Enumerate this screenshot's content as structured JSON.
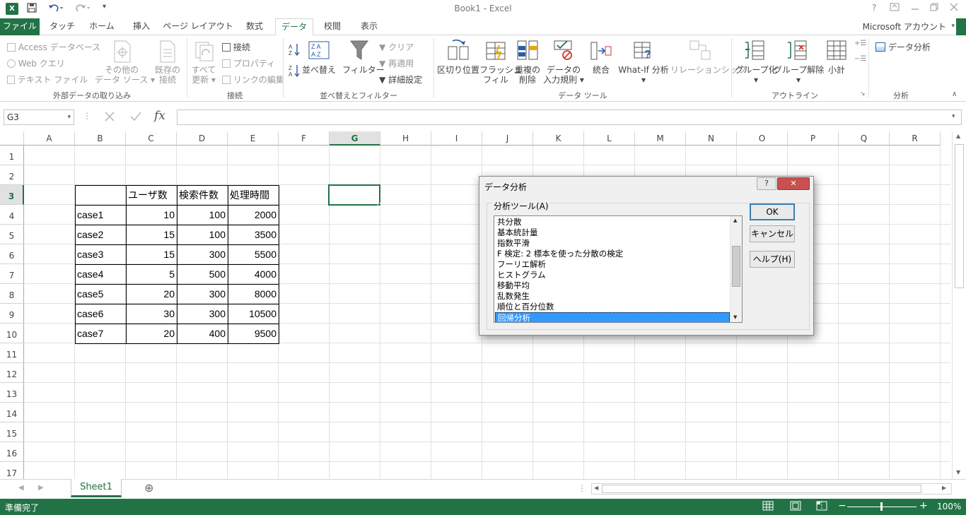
{
  "window": {
    "title": "Book1 - Excel",
    "app_icon": "X",
    "help": "?",
    "account": "Microsoft アカウント"
  },
  "tabs": [
    "ファイル",
    "タッチ",
    "ホーム",
    "挿入",
    "ページ レイアウト",
    "数式",
    "データ",
    "校閲",
    "表示"
  ],
  "ribbon": {
    "external": {
      "access": "Access データベース",
      "web": "Web クエリ",
      "text": "テキスト ファイル",
      "other_1": "その他の",
      "other_2": "データ ソース",
      "existing_1": "既存の",
      "existing_2": "接続",
      "label": "外部データの取り込み"
    },
    "connections": {
      "refresh_1": "すべて",
      "refresh_2": "更新",
      "connect": "接続",
      "props": "プロパティ",
      "edit_links": "リンクの編集",
      "label": "接続"
    },
    "sort": {
      "az": "A↓Z",
      "za": "Z↓A",
      "sort": "並べ替え",
      "filter": "フィルター",
      "clear": "クリア",
      "reapply": "再適用",
      "advanced": "詳細設定",
      "label": "並べ替えとフィルター"
    },
    "tools": {
      "split": "区切り位置",
      "flash_1": "フラッシュ",
      "flash_2": "フィル",
      "dup_1": "重複の",
      "dup_2": "削除",
      "valid_1": "データの",
      "valid_2": "入力規則",
      "consolidate": "統合",
      "whatif": "What-If 分析",
      "relation": "リレーションシップ",
      "label": "データ ツール"
    },
    "outline": {
      "group": "グループ化",
      "ungroup": "グループ解除",
      "subtotal": "小計",
      "label": "アウトライン"
    },
    "analysis": {
      "data_analysis": "データ分析",
      "label": "分析"
    }
  },
  "formula_bar": {
    "name_box": "G3",
    "formula": ""
  },
  "grid": {
    "columns": [
      "A",
      "B",
      "C",
      "D",
      "E",
      "F",
      "G",
      "H",
      "I",
      "J",
      "K",
      "L",
      "M",
      "N",
      "O",
      "P",
      "Q",
      "R"
    ],
    "rows": [
      "1",
      "2",
      "3",
      "4",
      "5",
      "6",
      "7",
      "8",
      "9",
      "10",
      "11",
      "12",
      "13",
      "14",
      "15",
      "16",
      "17"
    ],
    "selected_col": "G",
    "selected_row": "3"
  },
  "table": {
    "headers": [
      "",
      "ユーザ数",
      "検索件数",
      "処理時間"
    ],
    "rows": [
      [
        "case1",
        "10",
        "100",
        "2000"
      ],
      [
        "case2",
        "15",
        "100",
        "3500"
      ],
      [
        "case3",
        "15",
        "300",
        "5500"
      ],
      [
        "case4",
        "5",
        "500",
        "4000"
      ],
      [
        "case5",
        "20",
        "300",
        "8000"
      ],
      [
        "case6",
        "30",
        "300",
        "10500"
      ],
      [
        "case7",
        "20",
        "400",
        "9500"
      ]
    ]
  },
  "sheets": {
    "active": "Sheet1",
    "add": "⊕"
  },
  "status": {
    "ready": "準備完了",
    "zoom": "100%"
  },
  "dialog": {
    "title": "データ分析",
    "help": "?",
    "close": "✕",
    "tools_label": "分析ツール(A)",
    "items": [
      "共分散",
      "基本統計量",
      "指数平滑",
      "F 検定: 2 標本を使った分散の検定",
      "フーリエ解析",
      "ヒストグラム",
      "移動平均",
      "乱数発生",
      "順位と百分位数",
      "回帰分析"
    ],
    "selected_item": "回帰分析",
    "ok": "OK",
    "cancel": "キャンセル",
    "help_button": "ヘルプ(H)"
  },
  "colors": {
    "accent": "#217346",
    "selection": "#3399ff"
  }
}
